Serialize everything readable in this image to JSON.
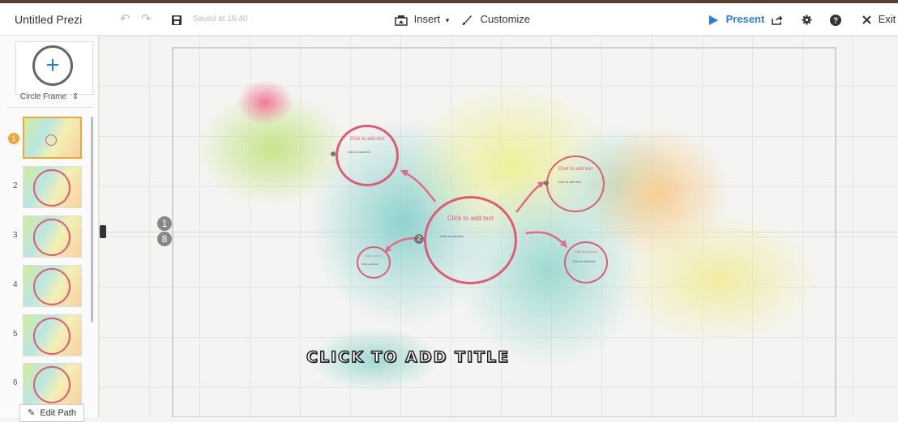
{
  "toolbar": {
    "title": "Untitled Prezi",
    "undo_icon": "undo-icon",
    "redo_icon": "redo-icon",
    "save_icon": "save-icon",
    "saved_text": "Saved at 16:40",
    "insert_label": "Insert",
    "insert_caret": "▾",
    "customize_label": "Customize",
    "present_label": "Present",
    "exit_label": "Exit",
    "accent_color": "#2a7de1"
  },
  "sidebar": {
    "add_frame_symbol": "+",
    "frame_type": "Circle Frame",
    "frame_type_arrows": "⇕",
    "steps": [
      {
        "number": "1",
        "active": true
      },
      {
        "number": "2",
        "active": false
      },
      {
        "number": "3",
        "active": false
      },
      {
        "number": "4",
        "active": false
      },
      {
        "number": "5",
        "active": false
      },
      {
        "number": "6",
        "active": false
      }
    ],
    "edit_path_label": "Edit Path"
  },
  "canvas": {
    "path_numbers": [
      "1",
      "8"
    ],
    "center_frame": {
      "title": "Click to add text",
      "body": "Click to add text",
      "step": "2"
    },
    "frames": [
      {
        "title": "Click to add text",
        "body": "Click to add text"
      },
      {
        "title": "Click to add text",
        "body": "Click to add text"
      },
      {
        "title": "Click to add text",
        "body": "Click to add text"
      },
      {
        "title": "Click to add text",
        "body": "Click to add text"
      }
    ],
    "main_title": "CLICK TO ADD TITLE",
    "frame_color": "#e05c75"
  }
}
